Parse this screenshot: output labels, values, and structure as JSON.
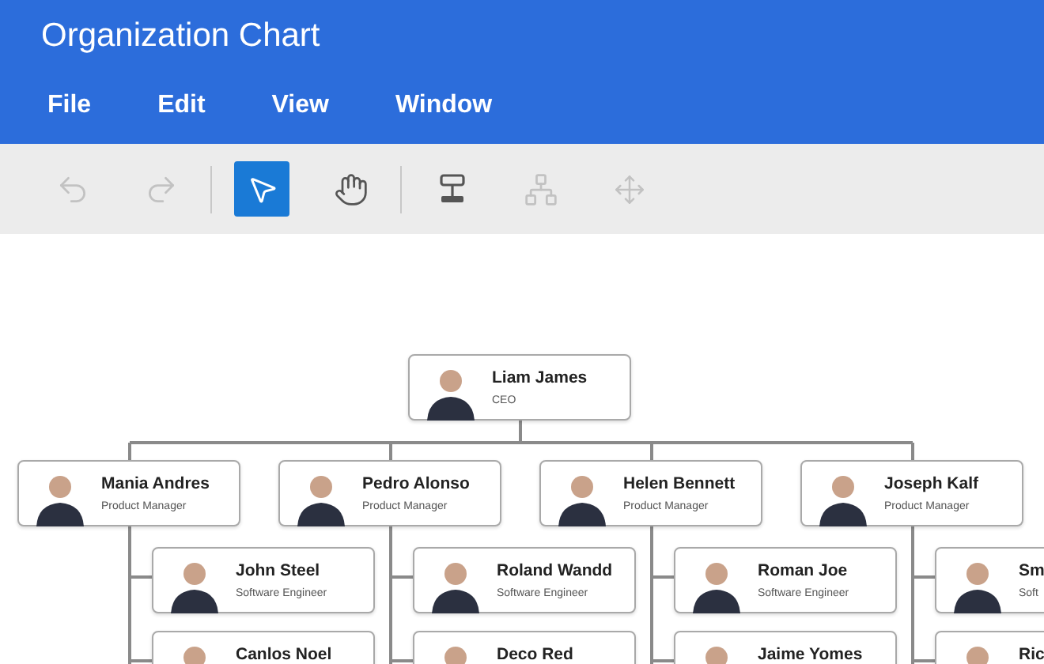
{
  "window": {
    "title": "Organization Chart"
  },
  "menu": [
    "File",
    "Edit",
    "View",
    "Window"
  ],
  "toolbar": {
    "groups": [
      [
        {
          "kind": "undo",
          "disabled": true,
          "selected": false
        },
        {
          "kind": "redo",
          "disabled": true,
          "selected": false
        }
      ],
      [
        {
          "kind": "pointer",
          "disabled": false,
          "selected": true
        },
        {
          "kind": "hand",
          "disabled": false,
          "selected": false
        }
      ],
      [
        {
          "kind": "add-node",
          "disabled": false,
          "selected": false
        },
        {
          "kind": "tree",
          "disabled": true,
          "selected": false
        },
        {
          "kind": "move",
          "disabled": true,
          "selected": false
        }
      ]
    ]
  },
  "chart": {
    "root": {
      "name": "Liam James",
      "role": "CEO",
      "children": [
        {
          "name": "Mania Andres",
          "role": "Product Manager",
          "children": [
            {
              "name": "John Steel",
              "role": "Software Engineer"
            },
            {
              "name": "Canlos Noel"
            }
          ]
        },
        {
          "name": "Pedro Alonso",
          "role": "Product Manager",
          "children": [
            {
              "name": "Roland Wandd",
              "role": "Software Engineer"
            },
            {
              "name": "Deco Red"
            }
          ]
        },
        {
          "name": "Helen Bennett",
          "role": "Product Manager",
          "children": [
            {
              "name": "Roman Joe",
              "role": "Software Engineer"
            },
            {
              "name": "Jaime Yomes"
            }
          ]
        },
        {
          "name": "Joseph Kalf",
          "role": "Product Manager",
          "children": [
            {
              "name": "Sm",
              "role": "Soft"
            },
            {
              "name": "Ric"
            }
          ]
        }
      ]
    }
  }
}
